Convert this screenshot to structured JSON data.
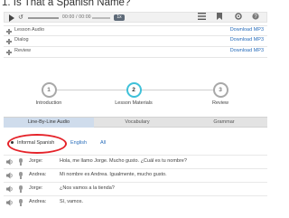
{
  "lesson": {
    "title": "1. Is That a Spanish Name?"
  },
  "player": {
    "time": "00:00 / 00:00",
    "speed": "1x",
    "rewind": "↺"
  },
  "files": [
    {
      "name": "Lesson Audio",
      "link": "Download MP3"
    },
    {
      "name": "Dialog",
      "link": "Download MP3"
    },
    {
      "name": "Review",
      "link": "Download MP3"
    }
  ],
  "steps": [
    {
      "number": "1",
      "label": "Introduction"
    },
    {
      "number": "2",
      "label": "Lesson Materials"
    },
    {
      "number": "3",
      "label": "Review"
    }
  ],
  "tabs": [
    "Line-By-Line Audio",
    "Vocabulary",
    "Grammar"
  ],
  "filters": [
    "Informal Spanish",
    "English",
    "All"
  ],
  "dialog": [
    {
      "speaker": "Jorge:",
      "text": "Hola, me llamo Jorge. Mucho gusto. ¿Cuál es tu nombre?"
    },
    {
      "speaker": "Andrea:",
      "text": "Mi nombre es Andrea. Igualmente, mucho gusto."
    },
    {
      "speaker": "Jorge:",
      "text": "¿Nos vamos a la tienda?"
    },
    {
      "speaker": "Andrea:",
      "text": "Sí, vamos."
    }
  ],
  "colors": {
    "accent": "#3fc1d9",
    "link": "#2a6ebb",
    "highlight": "#e5232a",
    "active_tab": "#cfdcec"
  },
  "icons": [
    "play-icon",
    "rewind-icon",
    "list-icon",
    "bookmark-icon",
    "settings-icon",
    "help-icon",
    "speaker-icon",
    "microphone-icon"
  ]
}
